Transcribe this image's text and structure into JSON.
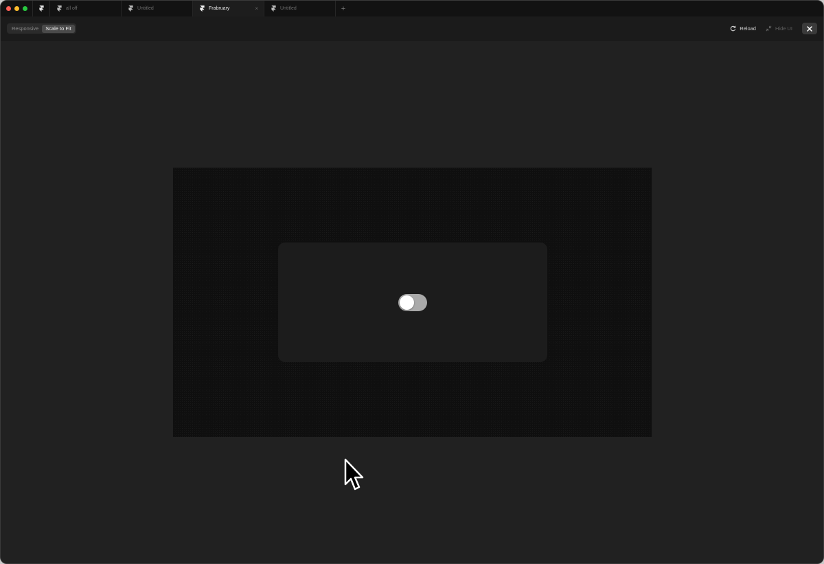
{
  "tabs": [
    {
      "label": "all off",
      "active": false,
      "icon": "framer-logo-icon"
    },
    {
      "label": "Untitled",
      "active": false,
      "icon": "framer-logo-icon"
    },
    {
      "label": "Frabruary",
      "active": true,
      "icon": "framer-logo-icon",
      "close": "×"
    },
    {
      "label": "Untitled",
      "active": false,
      "icon": "framer-logo-icon"
    }
  ],
  "add_tab_label": "+",
  "toolbar": {
    "segmented": [
      {
        "label": "Responsive",
        "active": false
      },
      {
        "label": "Scale to Fit",
        "active": true
      }
    ],
    "reload_label": "Reload",
    "hide_ui_label": "Hide UI",
    "close_icon": "close-icon"
  },
  "preview": {
    "toggle": {
      "state": "off",
      "track_color": "#a9a9a9",
      "knob_color": "#ffffff"
    }
  },
  "colors": {
    "window_bg": "#212121",
    "frame_bg": "#0f0f0f",
    "card_bg": "#1c1c1c",
    "traffic_red": "#ff5f57",
    "traffic_yellow": "#febc2e",
    "traffic_green": "#28c840"
  }
}
